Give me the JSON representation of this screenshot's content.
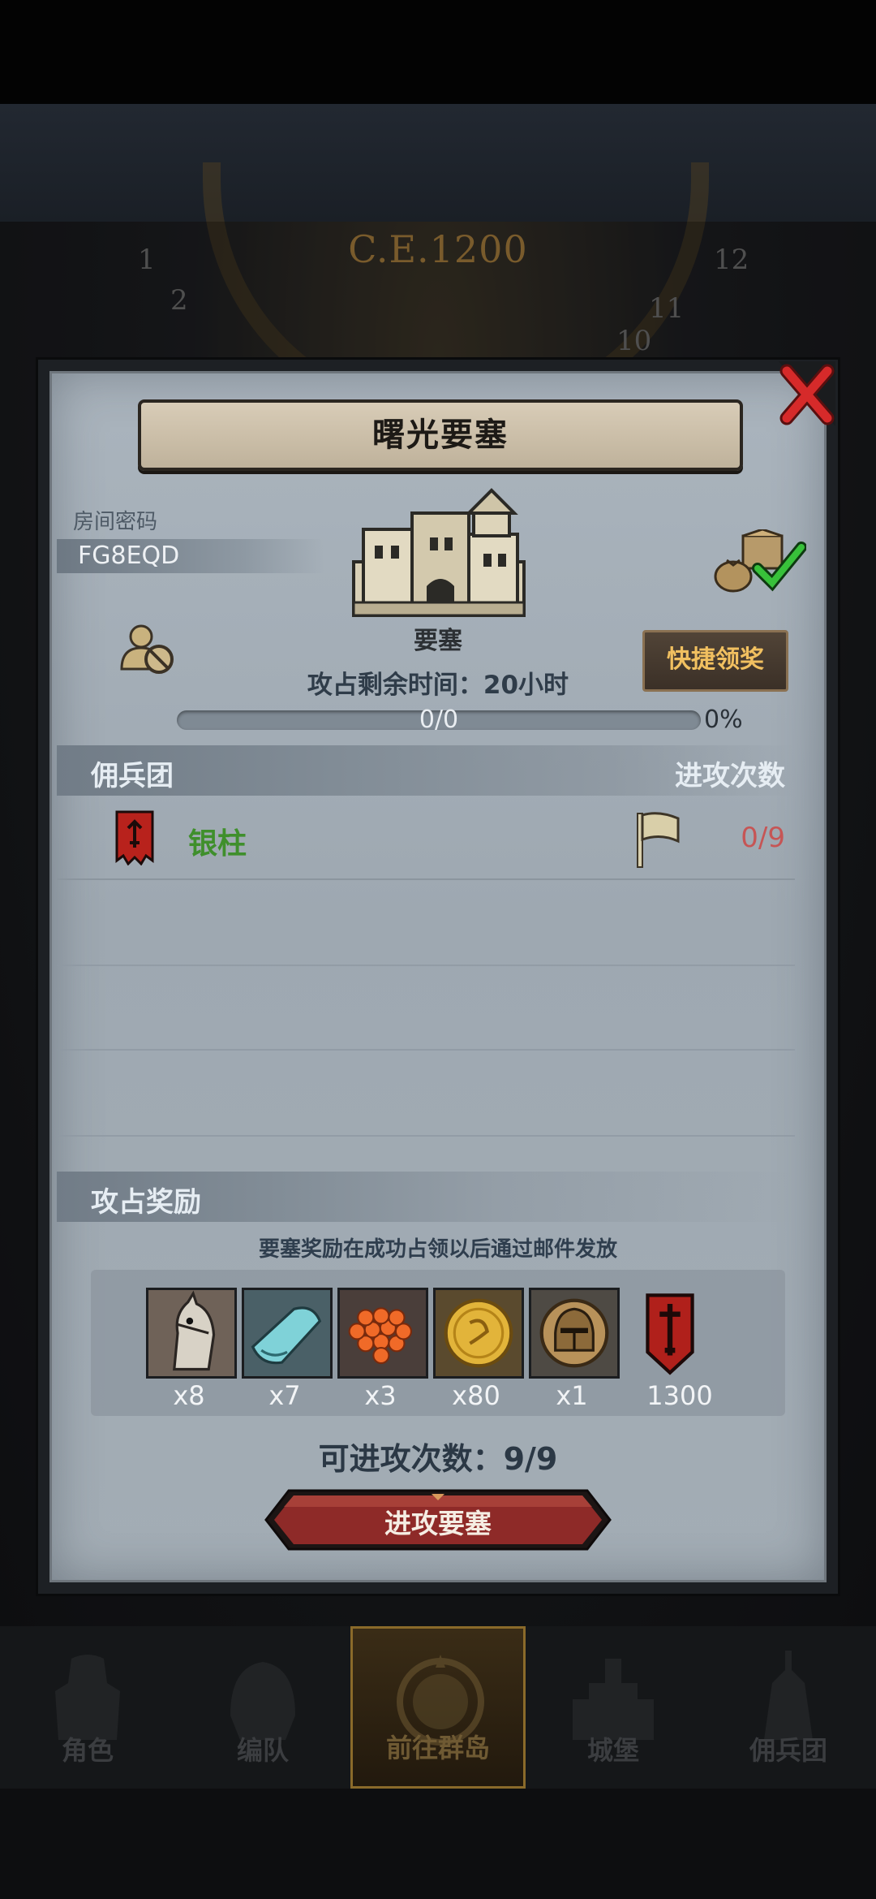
{
  "world": {
    "era_label": "C.E.1200",
    "clock_numbers": [
      "12",
      "11",
      "10",
      "1",
      "2"
    ]
  },
  "dialog": {
    "title": "曙光要塞",
    "room_password_label": "房间密码",
    "room_password": "FG8EQD",
    "building_label": "要塞",
    "quick_claim_label": "快捷领奖",
    "time_remaining": "攻占剩余时间：20小时",
    "progress": {
      "text": "0/0",
      "percent_text": "0%",
      "fraction": 0
    },
    "mercenary_header": "佣兵团",
    "attack_count_header": "进攻次数",
    "mercenaries": [
      {
        "name": "银柱",
        "attacks": "0/9"
      }
    ],
    "rewards_header": "攻占奖励",
    "rewards_note": "要塞奖励在成功占领以后通过邮件发放",
    "rewards": [
      {
        "icon": "horse-icon",
        "qty": "x8"
      },
      {
        "icon": "cloth-icon",
        "qty": "x7"
      },
      {
        "icon": "fish-roe-icon",
        "qty": "x3"
      },
      {
        "icon": "gold-coin-icon",
        "qty": "x80"
      },
      {
        "icon": "knight-helmet-icon",
        "qty": "x1"
      },
      {
        "icon": "sword-banner-icon",
        "qty": "1300"
      }
    ],
    "attempts_text": "可进攻次数：9/9",
    "attack_button": "进攻要塞"
  },
  "nav": {
    "items": [
      {
        "label": "角色",
        "icon": "knight-armor-icon"
      },
      {
        "label": "编队",
        "icon": "helmet-icon"
      },
      {
        "label": "前往群岛",
        "icon": "compass-map-icon",
        "active": true
      },
      {
        "label": "城堡",
        "icon": "castle-icon"
      },
      {
        "label": "佣兵团",
        "icon": "mercenary-icon"
      }
    ]
  },
  "colors": {
    "accent_gold": "#f1c060",
    "mercenary_name": "#3f8f2c",
    "attack_count": "#c65555",
    "attack_button": "#8e2a28"
  }
}
